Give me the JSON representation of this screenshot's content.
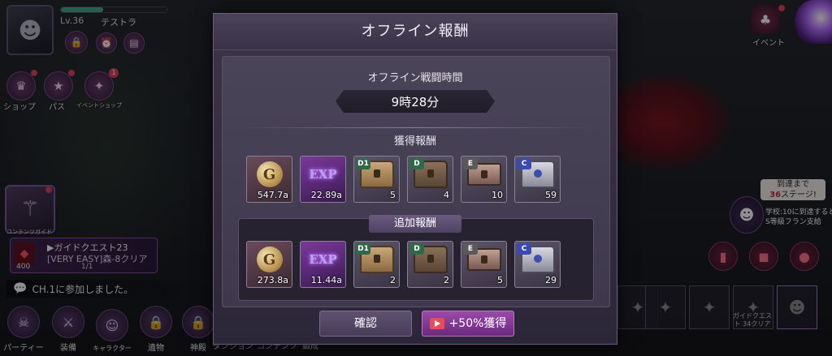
{
  "player": {
    "level": "Lv.36",
    "name": "テストラ"
  },
  "hud_left": {
    "shop_label": "ショップ",
    "pass_label": "パス",
    "event_shop_label": "イベントショップ",
    "event_shop_badge": "1"
  },
  "guide": {
    "label": "コンテンツガイド"
  },
  "quest": {
    "title": "▶ガイドクエスト23",
    "desc": "[VERY EASY]森-8クリア",
    "progress": "1/1",
    "count": "400"
  },
  "chat": {
    "message": "CH.1に参加しました。"
  },
  "bottom_nav": [
    {
      "label": "パーティー",
      "icon": "☠"
    },
    {
      "label": "装備",
      "icon": "⚔"
    },
    {
      "label": "キャラクター",
      "icon": "☺"
    },
    {
      "label": "遺物",
      "icon": "🔒"
    },
    {
      "label": "神殿",
      "icon": "🔒"
    }
  ],
  "bottom_text": {
    "dungeon": "ダンジョン",
    "content": "コンテンツ",
    "training": "鍛成"
  },
  "hud_right": {
    "event_label": "イベント",
    "stage_bubble_line1": "到達まで",
    "stage_bubble_num": "36",
    "stage_bubble_line2": "ステージ!",
    "school_line1": "学校:10に到達すると",
    "school_line2": "S等級フラン支給",
    "guide_quest_slot": "ガイドクエスト 34クリア"
  },
  "modal": {
    "title": "オフライン報酬",
    "battle_time_label": "オフライン戦闘時間",
    "battle_time_value": "9時28分",
    "acquired_label": "獲得報酬",
    "extra_label": "追加報酬",
    "confirm_label": "確認",
    "bonus_label": "+50%獲得"
  },
  "acquired_items": [
    {
      "type": "gold",
      "badge": "",
      "count": "547.7a"
    },
    {
      "type": "exp",
      "badge": "",
      "count": "22.89a"
    },
    {
      "type": "chest-d1",
      "badge": "D1",
      "count": "5"
    },
    {
      "type": "chest-d",
      "badge": "D",
      "count": "4"
    },
    {
      "type": "chest-e",
      "badge": "E",
      "count": "10"
    },
    {
      "type": "chest-c",
      "badge": "C",
      "count": "59"
    }
  ],
  "extra_items": [
    {
      "type": "gold",
      "badge": "",
      "count": "273.8a"
    },
    {
      "type": "exp",
      "badge": "",
      "count": "11.44a"
    },
    {
      "type": "chest-d1",
      "badge": "D1",
      "count": "2"
    },
    {
      "type": "chest-d",
      "badge": "D",
      "count": "2"
    },
    {
      "type": "chest-e",
      "badge": "E",
      "count": "5"
    },
    {
      "type": "chest-c",
      "badge": "C",
      "count": "29"
    }
  ],
  "icons": {
    "gold_glyph": "G",
    "exp_glyph": "EXP"
  }
}
